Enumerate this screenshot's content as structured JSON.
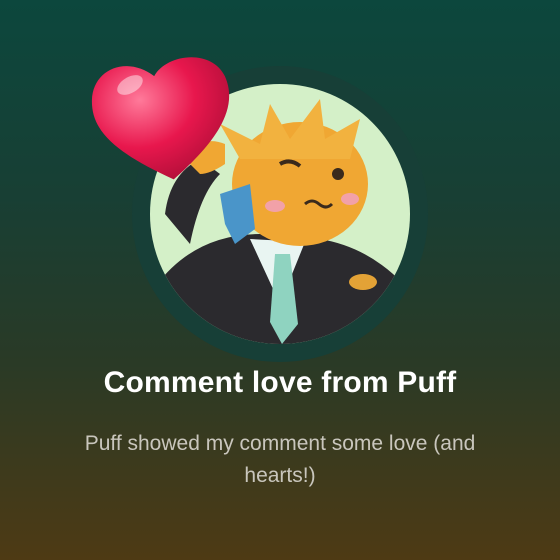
{
  "achievement": {
    "title": "Comment love from Puff",
    "description": "Puff showed my comment some love (and hearts!)",
    "avatar_icon": "puff-character-avatar",
    "badge_icon": "heart-icon"
  },
  "colors": {
    "ring": "#19433a",
    "avatar_bg": "#d4f0c8",
    "heart": "#e8174d",
    "fur": "#f0a733",
    "suit": "#2b2a2e",
    "tie": "#8fd3c0"
  }
}
